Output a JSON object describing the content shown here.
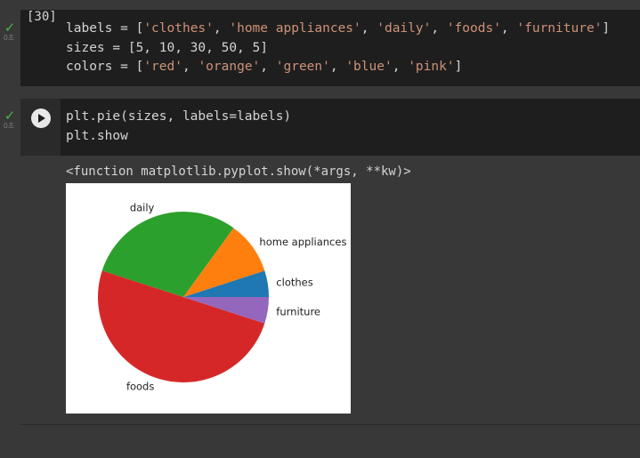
{
  "cell1": {
    "status_time": "0초",
    "exec_count": "[30]",
    "line1": {
      "prefix": "labels = [",
      "items": [
        "'clothes'",
        "'home appliances'",
        "'daily'",
        "'foods'",
        "'furniture'"
      ],
      "suffix": "]"
    },
    "line2": "sizes = [5, 10, 30, 50, 5]",
    "line3": {
      "prefix": "colors = [",
      "items": [
        "'red'",
        "'orange'",
        "'green'",
        "'blue'",
        "'pink'"
      ],
      "suffix": "]"
    }
  },
  "cell2": {
    "status_time": "0초",
    "line1": "plt.pie(sizes, labels=labels)",
    "line2": "plt.show",
    "output_text": "<function matplotlib.pyplot.show(*args, **kw)>"
  },
  "chart_data": {
    "type": "pie",
    "categories": [
      "clothes",
      "home appliances",
      "daily",
      "foods",
      "furniture"
    ],
    "values": [
      5,
      10,
      30,
      50,
      5
    ],
    "colors": [
      "#1f77b4",
      "#ff7f0e",
      "#2ca02c",
      "#d62728",
      "#9467bd"
    ],
    "start_angle": 0,
    "direction": "counterclockwise"
  }
}
